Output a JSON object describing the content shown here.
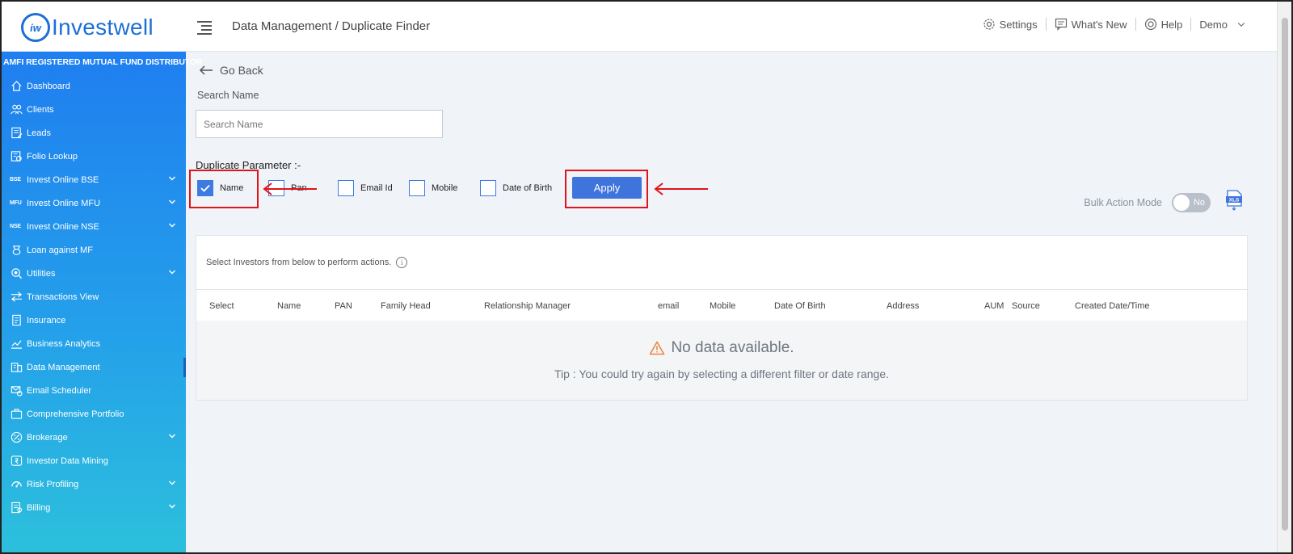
{
  "header": {
    "logo_text": "Investwell",
    "logo_mark": "iw",
    "breadcrumb": "Data Management / Duplicate Finder",
    "settings": "Settings",
    "whats_new": "What's New",
    "help": "Help",
    "user": "Demo"
  },
  "sidebar": {
    "banner": "AMFI REGISTERED MUTUAL FUND DISTRIBUTOR",
    "items": [
      {
        "label": "Dashboard",
        "icon": "home-icon"
      },
      {
        "label": "Clients",
        "icon": "users-icon"
      },
      {
        "label": "Leads",
        "icon": "leads-icon"
      },
      {
        "label": "Folio Lookup",
        "icon": "folio-icon"
      },
      {
        "label": "Invest Online BSE",
        "tag": "BSE"
      },
      {
        "label": "Invest Online MFU",
        "tag": "MFU"
      },
      {
        "label": "Invest Online NSE",
        "tag": "NSE"
      },
      {
        "label": "Loan against MF",
        "icon": "loan-icon"
      },
      {
        "label": "Utilities",
        "icon": "utilities-icon"
      },
      {
        "label": "Transactions View",
        "icon": "transactions-icon"
      },
      {
        "label": "Insurance",
        "icon": "insurance-icon"
      },
      {
        "label": "Business Analytics",
        "icon": "analytics-icon"
      },
      {
        "label": "Data Management",
        "icon": "data-icon"
      },
      {
        "label": "Email Scheduler",
        "icon": "email-icon"
      },
      {
        "label": "Comprehensive Portfolio",
        "icon": "portfolio-icon"
      },
      {
        "label": "Brokerage",
        "icon": "brokerage-icon"
      },
      {
        "label": "Investor Data Mining",
        "icon": "mining-icon"
      },
      {
        "label": "Risk Profiling",
        "icon": "risk-icon"
      },
      {
        "label": "Billing",
        "icon": "billing-icon"
      }
    ]
  },
  "main": {
    "go_back": "Go Back",
    "search_label": "Search Name",
    "search_placeholder": "Search Name",
    "search_value": "",
    "duplicate_label": "Duplicate Parameter :-",
    "params": [
      {
        "label": "Name",
        "checked": true
      },
      {
        "label": "Pan",
        "checked": false
      },
      {
        "label": "Email Id",
        "checked": false
      },
      {
        "label": "Mobile",
        "checked": false
      },
      {
        "label": "Date of Birth",
        "checked": false
      }
    ],
    "apply_label": "Apply",
    "bulk_label": "Bulk Action Mode",
    "bulk_value": "No",
    "xls_label": "XLS",
    "hint": "Select Investors from below to perform actions.",
    "info_glyph": "i",
    "columns": [
      "Select",
      "Name",
      "PAN",
      "Family Head",
      "Relationship Manager",
      "email",
      "Mobile",
      "Date Of Birth",
      "Address",
      "AUM",
      "Source",
      "Created Date/Time"
    ],
    "empty_title": "No data available.",
    "empty_tip": "Tip : You could try again by selecting a different filter or date range."
  },
  "colors": {
    "brand": "#1c6fd6",
    "apply": "#3e74dc",
    "highlight": "#e0141a",
    "warning": "#f0843c"
  }
}
